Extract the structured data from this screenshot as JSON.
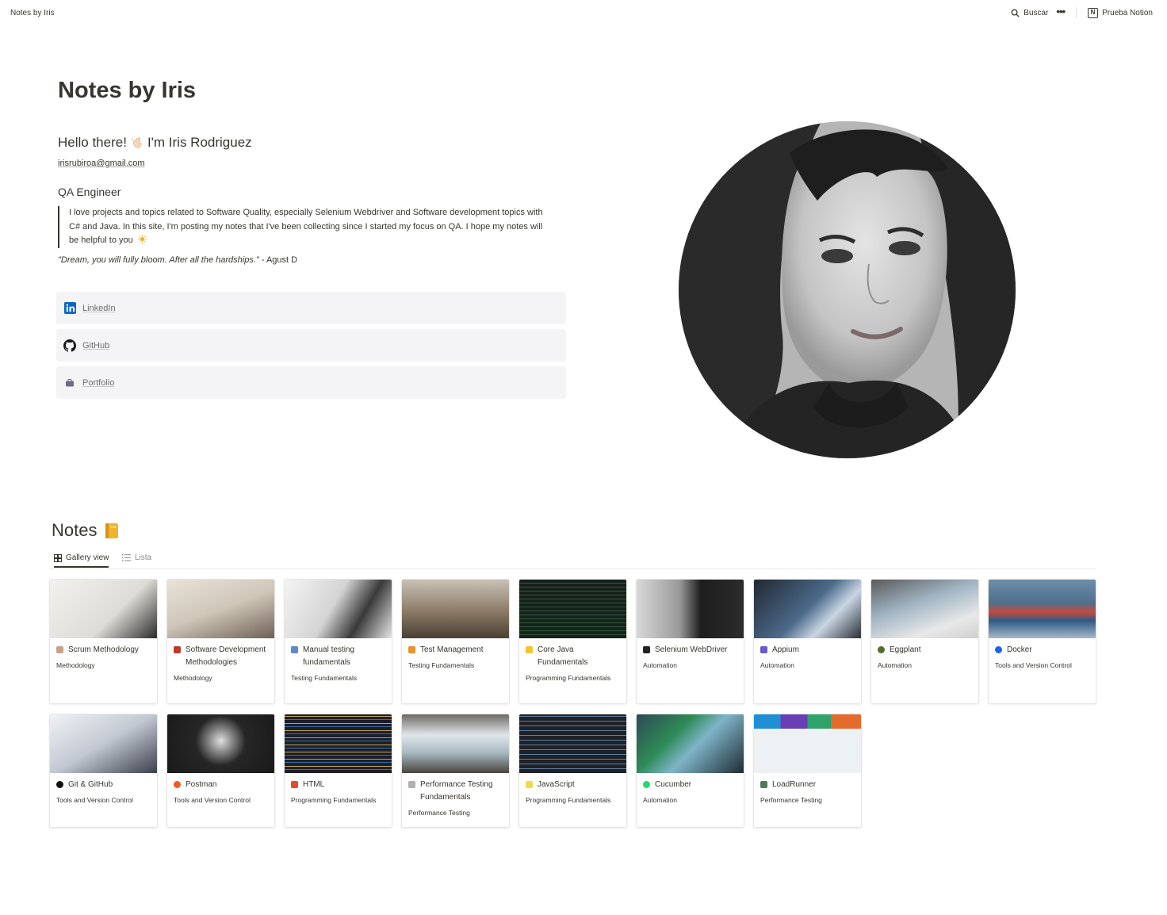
{
  "topbar": {
    "breadcrumb": "Notes by Iris",
    "search_label": "Buscar",
    "more_label": "•••",
    "workspace_label": "Prueba Notion",
    "workspace_logo": "N"
  },
  "header": {
    "title": "Notes by Iris",
    "greeting_part1": "Hello there!",
    "greeting_part2": "I'm Iris Rodriguez",
    "email": "irisrubiroa@gmail.com",
    "role": "QA Engineer",
    "bio": "I love projects and topics related to Software Quality, especially Selenium Webdriver and Software development topics with C# and Java. In this site, I'm posting my notes that I've been collecting since I started my focus on QA. I hope my notes will be helpful to you",
    "quote_text": "\"Dream, you will fully bloom. After all the hardships.\"",
    "quote_author": " - Agust D"
  },
  "links": [
    {
      "label": "LinkedIn",
      "icon": "linkedin-icon"
    },
    {
      "label": "GitHub",
      "icon": "github-icon"
    },
    {
      "label": "Portfolio",
      "icon": "briefcase-icon"
    }
  ],
  "notes": {
    "title": "Notes",
    "tabs": [
      {
        "label": "Gallery view",
        "active": true
      },
      {
        "label": "Lista",
        "active": false
      }
    ],
    "cards": [
      {
        "title": "Scrum Methodology",
        "tag": "Methodology",
        "icon_color": "#c9a18c",
        "thumb": "#e9e7e3"
      },
      {
        "title": "Software Development Methodologies",
        "tag": "Methodology",
        "icon_color": "#c0392b",
        "thumb": "#d8d3cb"
      },
      {
        "title": "Manual testing fundamentals",
        "tag": "Testing Fundamentals",
        "icon_color": "#5b8ac7",
        "thumb": "#cfcfcf"
      },
      {
        "title": "Test Management",
        "tag": "Testing Fundamentals",
        "icon_color": "#e8912d",
        "thumb": "#a89a86"
      },
      {
        "title": "Core Java Fundamentals",
        "tag": "Programming Fundamentals",
        "icon_color": "#f4c430",
        "thumb": "#1f2b24"
      },
      {
        "title": "Selenium WebDriver",
        "tag": "Automation",
        "icon_color": "#222222",
        "thumb": "#2b2b2b"
      },
      {
        "title": "Appium",
        "tag": "Automation",
        "icon_color": "#6a5acd",
        "thumb": "#3a4250"
      },
      {
        "title": "Eggplant",
        "tag": "Automation",
        "icon_color": "#556b2f",
        "thumb": "#8e8e8e"
      },
      {
        "title": "Docker",
        "tag": "Tools and Version Control",
        "icon_color": "#1d63ed",
        "thumb": "#6b93b7"
      },
      {
        "title": "Git & GitHub",
        "tag": "Tools and Version Control",
        "icon_color": "#111111",
        "thumb": "#c9ccd3"
      },
      {
        "title": "Postman",
        "tag": "Tools and Version Control",
        "icon_color": "#ef5b25",
        "thumb": "#262626"
      },
      {
        "title": "HTML",
        "tag": "Programming Fundamentals",
        "icon_color": "#e34c26",
        "thumb": "#1c1e2a"
      },
      {
        "title": "Performance Testing Fundamentals",
        "tag": "Performance Testing",
        "icon_color": "#b0b0b0",
        "thumb": "#8d8a85"
      },
      {
        "title": "JavaScript",
        "tag": "Programming Fundamentals",
        "icon_color": "#f0db4f",
        "thumb": "#1e2128"
      },
      {
        "title": "Cucumber",
        "tag": "Automation",
        "icon_color": "#23d96c",
        "thumb": "#2f4a55"
      },
      {
        "title": "LoadRunner",
        "tag": "Performance Testing",
        "icon_color": "#4a7c59",
        "thumb": "#dfe4ea"
      }
    ]
  },
  "colors": {
    "text": "#37352f",
    "muted": "#8b8a86",
    "link_block_bg": "#f4f4f7"
  }
}
